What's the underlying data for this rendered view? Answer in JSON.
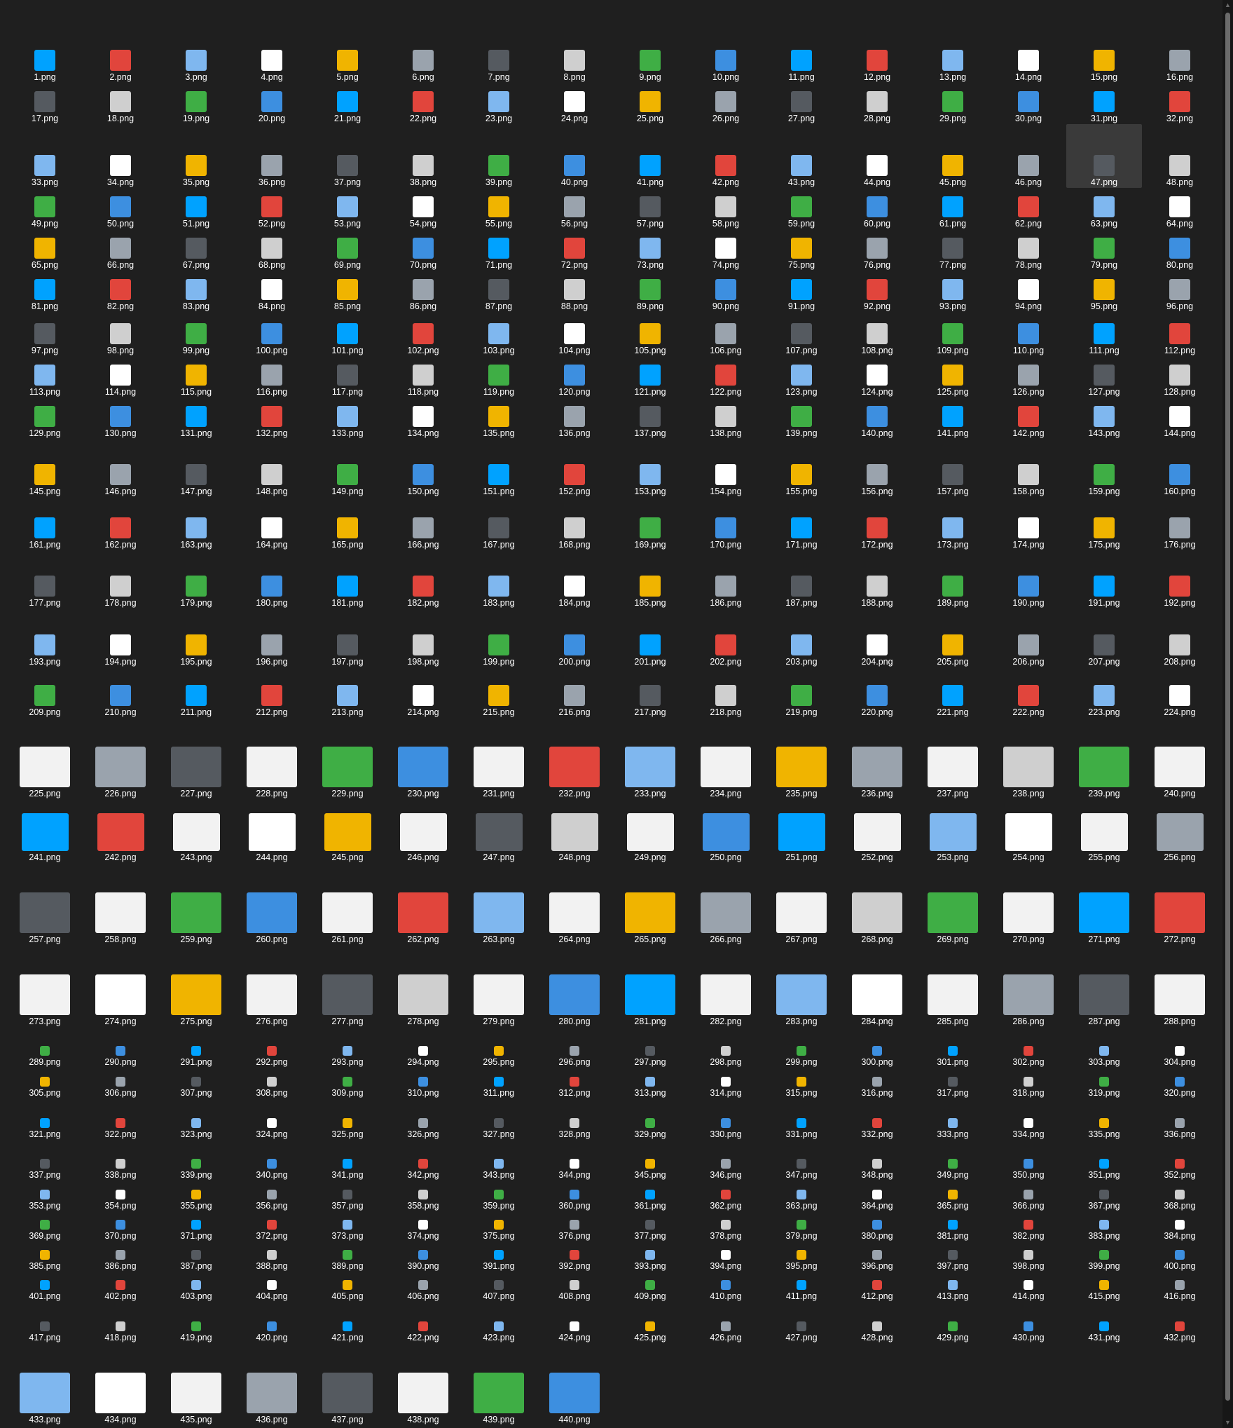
{
  "folder_view": {
    "file_extension": ".png",
    "selected_file": "47.png",
    "file_count": 440,
    "rows": [
      {
        "range": [
          1,
          16
        ],
        "icon_size": "small"
      },
      {
        "range": [
          17,
          32
        ],
        "icon_size": "small"
      },
      {
        "range": [
          33,
          48
        ],
        "icon_size": "small"
      },
      {
        "range": [
          49,
          64
        ],
        "icon_size": "small"
      },
      {
        "range": [
          65,
          80
        ],
        "icon_size": "small"
      },
      {
        "range": [
          81,
          96
        ],
        "icon_size": "small"
      },
      {
        "range": [
          97,
          112
        ],
        "icon_size": "small"
      },
      {
        "range": [
          113,
          128
        ],
        "icon_size": "small"
      },
      {
        "range": [
          129,
          144
        ],
        "icon_size": "small"
      },
      {
        "range": [
          145,
          160
        ],
        "icon_size": "small"
      },
      {
        "range": [
          161,
          176
        ],
        "icon_size": "small"
      },
      {
        "range": [
          177,
          192
        ],
        "icon_size": "small"
      },
      {
        "range": [
          193,
          208
        ],
        "icon_size": "small"
      },
      {
        "range": [
          209,
          224
        ],
        "icon_size": "small"
      },
      {
        "range": [
          225,
          240
        ],
        "icon_size": "large"
      },
      {
        "range": [
          241,
          256
        ],
        "icon_size": "large"
      },
      {
        "range": [
          257,
          272
        ],
        "icon_size": "large"
      },
      {
        "range": [
          273,
          288
        ],
        "icon_size": "large"
      },
      {
        "range": [
          289,
          304
        ],
        "icon_size": "tiny"
      },
      {
        "range": [
          305,
          320
        ],
        "icon_size": "tiny"
      },
      {
        "range": [
          321,
          336
        ],
        "icon_size": "tiny"
      },
      {
        "range": [
          337,
          352
        ],
        "icon_size": "tiny"
      },
      {
        "range": [
          353,
          368
        ],
        "icon_size": "tiny"
      },
      {
        "range": [
          369,
          384
        ],
        "icon_size": "tiny"
      },
      {
        "range": [
          385,
          400
        ],
        "icon_size": "tiny"
      },
      {
        "range": [
          401,
          416
        ],
        "icon_size": "tiny"
      },
      {
        "range": [
          417,
          432
        ],
        "icon_size": "tiny"
      },
      {
        "range": [
          433,
          440
        ],
        "icon_size": "large"
      }
    ],
    "palette": [
      "#3d8fe0",
      "#7fb7ef",
      "#9aa3ad",
      "#3fae45",
      "#e1453c",
      "#f0b400",
      "#cfcfcf",
      "#00a2ff",
      "#ffffff",
      "#555a60"
    ]
  },
  "scrollbar": {
    "up_arrow": "▲",
    "down_arrow": "▼"
  }
}
